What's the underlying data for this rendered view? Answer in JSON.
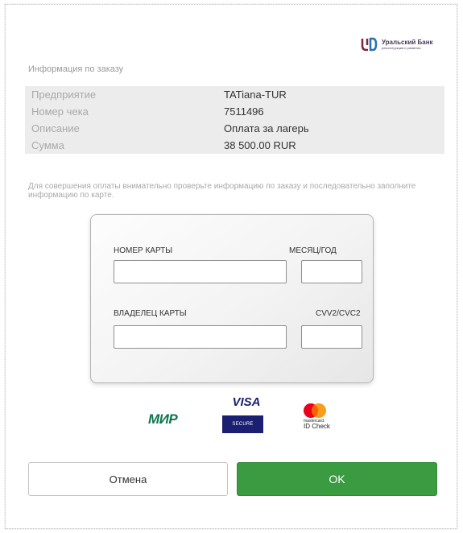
{
  "bank": {
    "name": "Уральский Банк",
    "tagline": "реконструкции и развития",
    "logo_icon": "ubrr-logo-icon",
    "colors": {
      "logo_left": "#7a2740",
      "logo_right": "#2a6fb0"
    }
  },
  "order": {
    "title": "Информация по заказу",
    "rows": [
      {
        "label": "Предприятие",
        "value": "TATiana-TUR"
      },
      {
        "label": "Номер чека",
        "value": "7511496"
      },
      {
        "label": "Описание",
        "value": "Оплата за лагерь"
      },
      {
        "label": "Сумма",
        "value": "38 500.00 RUR"
      }
    ]
  },
  "notice": "Для совершения оплаты внимательно проверьте информацию по заказу и последовательно заполните информацию по карте.",
  "card_form": {
    "card_number_label": "НОМЕР КАРТЫ",
    "card_number_value": "",
    "expiry_label": "МЕСЯЦ/ГОД",
    "expiry_value": "",
    "holder_label": "ВЛАДЕЛЕЦ КАРТЫ",
    "holder_value": "",
    "cvv_label": "CVV2/CVC2",
    "cvv_value": ""
  },
  "payment_logos": {
    "mir": "МИР",
    "visa": "VISA",
    "visa_secure": "SECURE",
    "mastercard_small": "mastercard.",
    "mastercard_check": "ID Check",
    "colors": {
      "mir": "#0f754e",
      "visa": "#1a1f71",
      "mc_red": "#eb001b",
      "mc_orange": "#f79e1b"
    }
  },
  "actions": {
    "cancel_label": "Отмена",
    "ok_label": "OK",
    "ok_color": "#3a9b41"
  }
}
